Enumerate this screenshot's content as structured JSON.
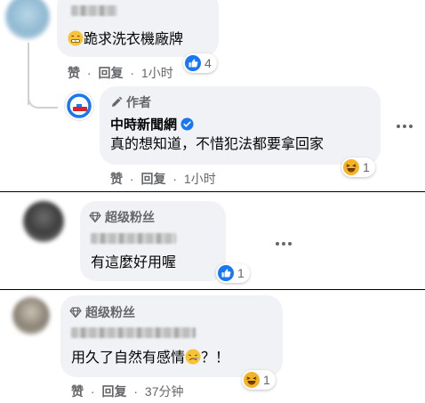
{
  "comments": [
    {
      "author_redacted": true,
      "text": "跪求洗衣機廠牌",
      "reaction_count": "4",
      "actions": {
        "like": "赞",
        "reply": "回复",
        "time": "1小时"
      }
    },
    {
      "badge": "作者",
      "author": "中時新聞網",
      "text": "真的想知道，不惜犯法都要拿回家",
      "reaction_count": "1",
      "actions": {
        "like": "赞",
        "reply": "回复",
        "time": "1小时"
      }
    },
    {
      "badge": "超级粉丝",
      "author_redacted": true,
      "text": "有這麼好用喔",
      "reaction_count": "1"
    },
    {
      "badge": "超级粉丝",
      "author_redacted": true,
      "text_before": "用久了自然有感情",
      "text_after": "？！",
      "reaction_count": "1",
      "actions": {
        "like": "赞",
        "reply": "回复",
        "time": "37分钟"
      }
    }
  ],
  "icons": {
    "like": "like-reaction-icon",
    "haha": "haha-reaction-icon",
    "verified": "verified-badge-icon",
    "pencil": "pencil-icon",
    "diamond": "diamond-icon",
    "more": "more-options-icon"
  },
  "colors": {
    "like_blue": "#1877f2",
    "haha_yellow": "#f7b125",
    "bubble_bg": "#f0f2f5",
    "meta_gray": "#65676b"
  }
}
